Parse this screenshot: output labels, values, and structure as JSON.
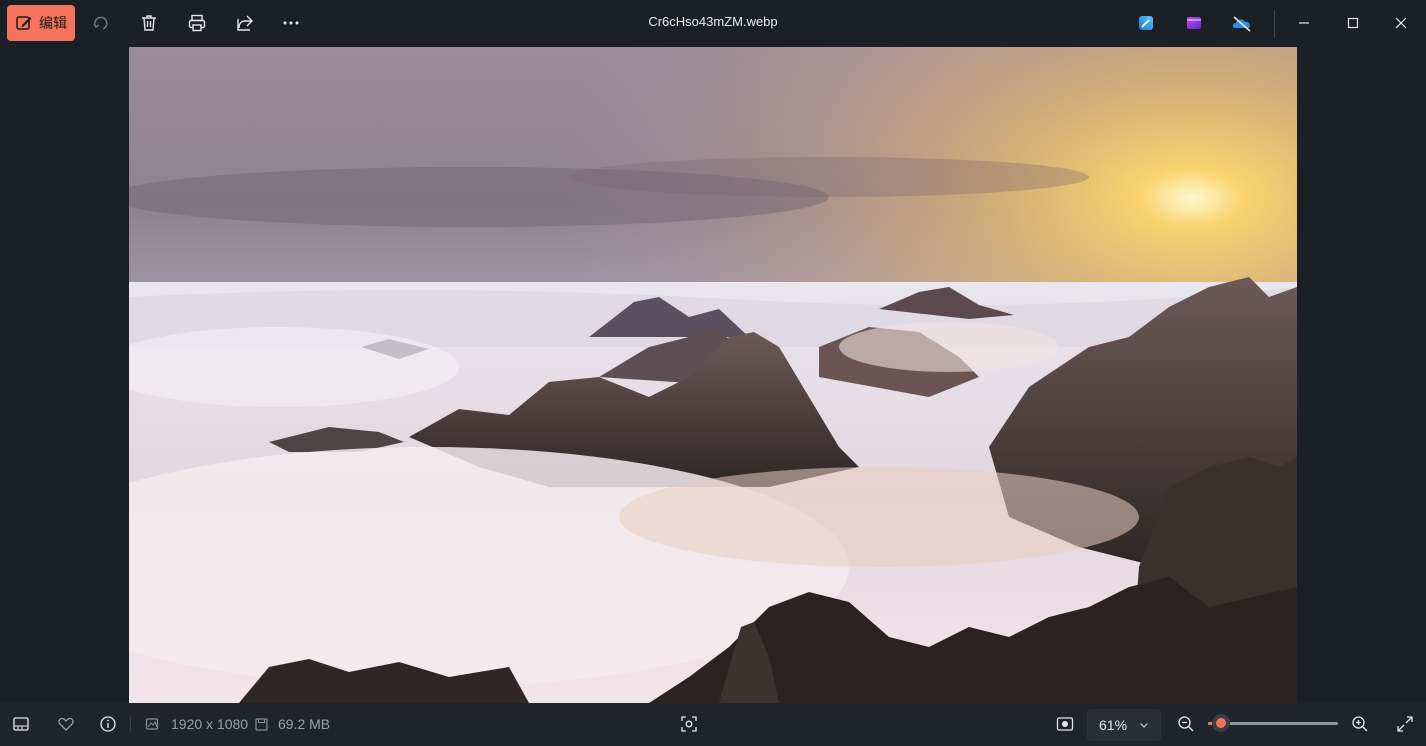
{
  "toolbar": {
    "edit_label": "编辑",
    "icons": [
      "edit-icon",
      "rotate-icon",
      "delete-icon",
      "print-icon",
      "share-icon",
      "more-icon"
    ]
  },
  "window": {
    "title": "Cr6cHso43mZM.webp",
    "app_icons": [
      "designer-icon",
      "clipchamp-icon",
      "onedrive-icon"
    ],
    "controls": [
      "minimize-icon",
      "maximize-icon",
      "close-icon"
    ]
  },
  "statusbar": {
    "dimensions": "1920 x 1080",
    "file_size": "69.2 MB",
    "zoom": "61%",
    "zoom_fraction": 0.1
  },
  "colors": {
    "accent": "#f4735d",
    "background": "#1b1f26"
  }
}
